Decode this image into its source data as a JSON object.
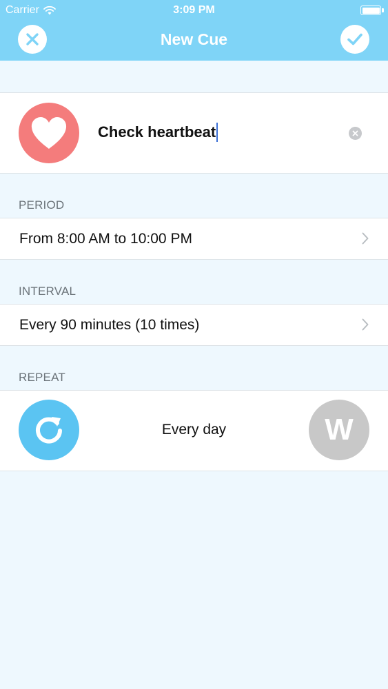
{
  "status_bar": {
    "carrier": "Carrier",
    "time": "3:09 PM"
  },
  "nav": {
    "title": "New Cue",
    "cancel_icon": "close-icon",
    "confirm_icon": "checkmark-icon"
  },
  "cue": {
    "icon": "heart-icon",
    "name": "Check heartbeat",
    "clear_icon": "clear-icon"
  },
  "period": {
    "section_label": "PERIOD",
    "value": "From 8:00 AM to 10:00 PM"
  },
  "interval": {
    "section_label": "INTERVAL",
    "value": "Every 90 minutes (10 times)"
  },
  "repeat": {
    "section_label": "REPEAT",
    "icon": "repeat-icon",
    "value": "Every day",
    "weekday_button": "W"
  },
  "colors": {
    "header": "#7fd4f7",
    "background": "#eef8fe",
    "heart": "#f47c7c",
    "repeat": "#5bc4f2",
    "weekday": "#c8c8c8"
  }
}
